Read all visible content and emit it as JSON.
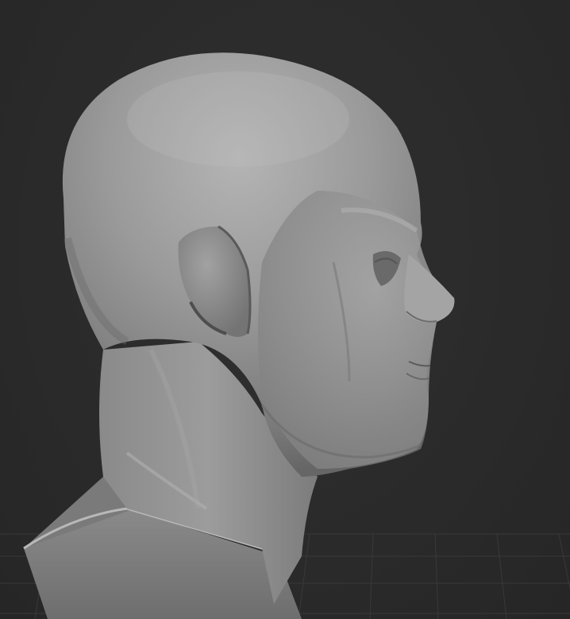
{
  "viewport": {
    "background_color": "#2b2b2b",
    "grid_color": "#3a3a3a",
    "model_color": "#8e8e8e",
    "subject": "sculpted-head-bust-side-view"
  }
}
